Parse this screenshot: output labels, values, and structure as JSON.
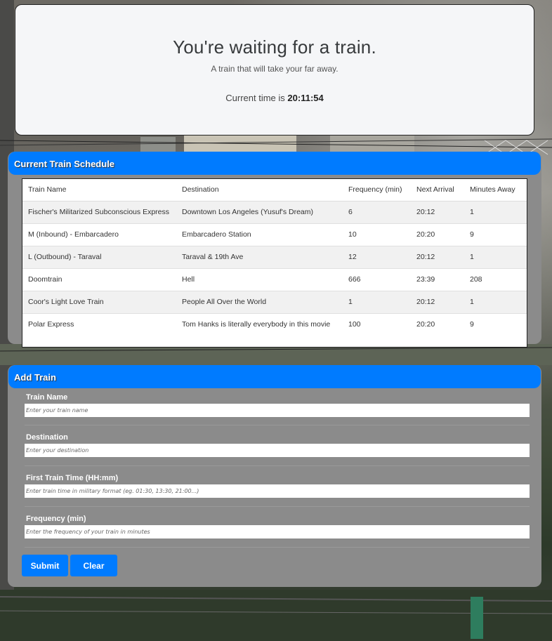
{
  "header": {
    "title": "You're waiting for a train.",
    "subtitle": "A train that will take your far away.",
    "time_label": "Current time is",
    "current_time": "20:11:54"
  },
  "schedule": {
    "heading": "Current Train Schedule",
    "columns": [
      "Train Name",
      "Destination",
      "Frequency (min)",
      "Next Arrival",
      "Minutes Away"
    ],
    "rows": [
      [
        "Fischer's Militarized Subconscious Express",
        "Downtown Los Angeles (Yusuf's Dream)",
        "6",
        "20:12",
        "1"
      ],
      [
        "M (Inbound) - Embarcadero",
        "Embarcadero Station",
        "10",
        "20:20",
        "9"
      ],
      [
        "L (Outbound) - Taraval",
        "Taraval & 19th Ave",
        "12",
        "20:12",
        "1"
      ],
      [
        "Doomtrain",
        "Hell",
        "666",
        "23:39",
        "208"
      ],
      [
        "Coor's Light Love Train",
        "People All Over the World",
        "1",
        "20:12",
        "1"
      ],
      [
        "Polar Express",
        "Tom Hanks is literally everybody in this movie",
        "100",
        "20:20",
        "9"
      ]
    ]
  },
  "form": {
    "heading": "Add Train",
    "train_name_label": "Train Name",
    "train_name_placeholder": "Enter your train name",
    "destination_label": "Destination",
    "destination_placeholder": "Enter your destination",
    "first_time_label": "First Train Time (HH:mm)",
    "first_time_placeholder": "Enter train time in military format (eg. 01:30, 13:30, 21:00...)",
    "frequency_label": "Frequency (min)",
    "frequency_placeholder": "Enter the frequency of your train in minutes",
    "submit_label": "Submit",
    "clear_label": "Clear"
  },
  "colors": {
    "accent": "#007bff",
    "panel": "#8b8b8b"
  }
}
